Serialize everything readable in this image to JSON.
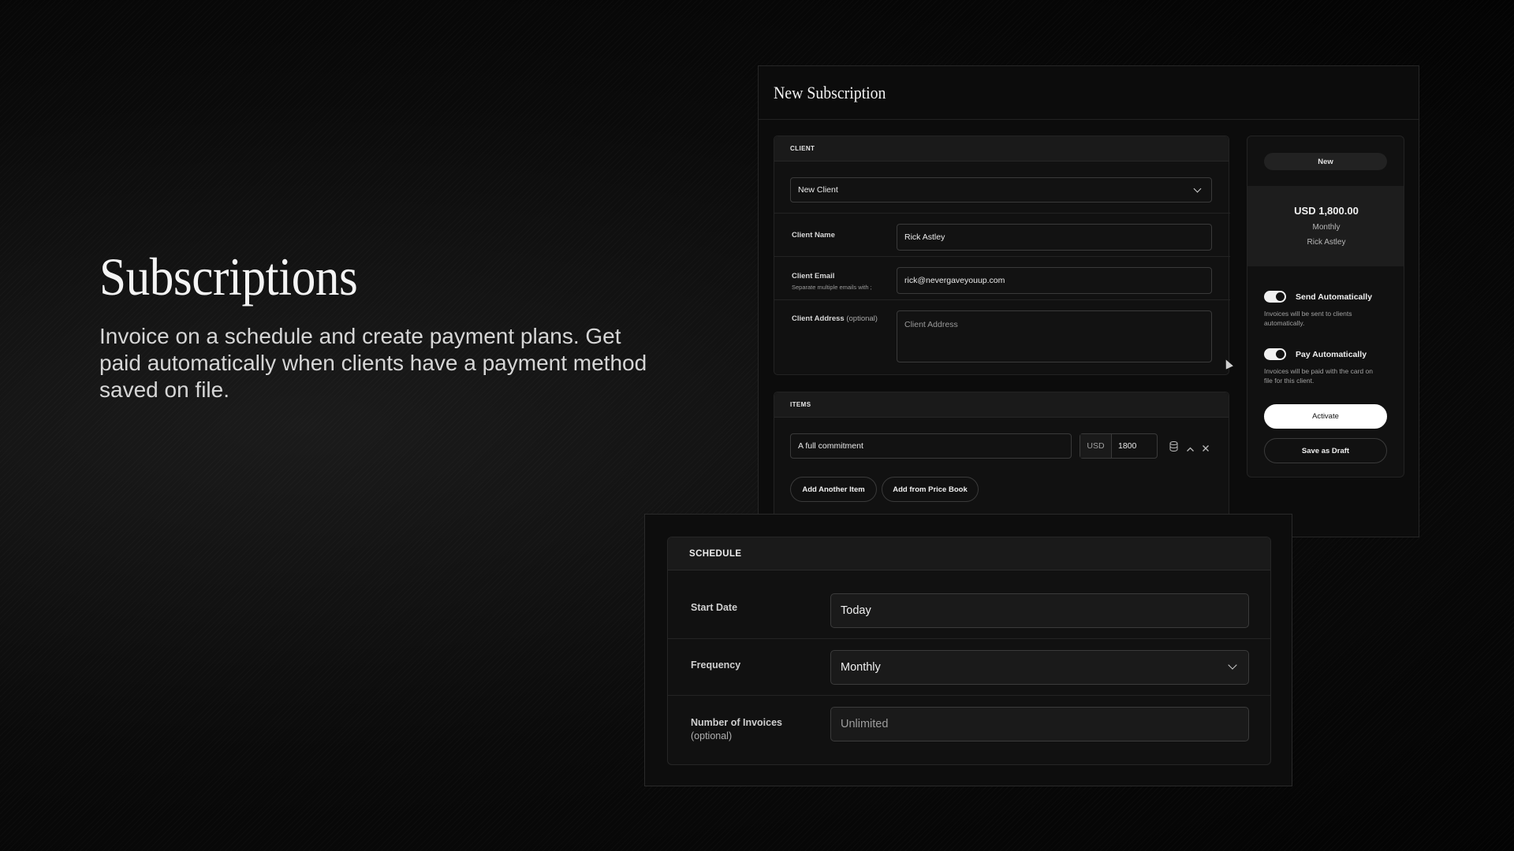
{
  "hero": {
    "title": "Subscriptions",
    "description": "Invoice on a schedule and create payment plans. Get paid automatically when clients have a payment method saved on file."
  },
  "panel": {
    "title": "New Subscription"
  },
  "client": {
    "section_title": "CLIENT",
    "select_value": "New Client",
    "name_label": "Client Name",
    "name_value": "Rick Astley",
    "email_label": "Client Email",
    "email_hint": "Separate multiple emails with ;",
    "email_value": "rick@nevergaveyouup.com",
    "address_label": "Client Address",
    "address_optional": "(optional)",
    "address_placeholder": "Client Address"
  },
  "items": {
    "section_title": "ITEMS",
    "rows": [
      {
        "description": "A full commitment",
        "currency": "USD",
        "amount": "1800"
      }
    ],
    "add_item_label": "Add Another Item",
    "add_price_book_label": "Add from Price Book"
  },
  "sidebar": {
    "status_badge": "New",
    "total": "USD 1,800.00",
    "frequency": "Monthly",
    "client_name": "Rick Astley",
    "send_auto_label": "Send Automatically",
    "send_auto_desc": "Invoices will be sent to clients automatically.",
    "pay_auto_label": "Pay Automatically",
    "pay_auto_desc": "Invoices will be paid with the card on file for this client.",
    "activate_label": "Activate",
    "save_draft_label": "Save as Draft"
  },
  "schedule": {
    "section_title": "SCHEDULE",
    "start_date_label": "Start Date",
    "start_date_value": "Today",
    "frequency_label": "Frequency",
    "frequency_value": "Monthly",
    "invoices_label": "Number of Invoices",
    "invoices_optional": "(optional)",
    "invoices_placeholder": "Unlimited"
  },
  "colors": {
    "background": "#050505",
    "panel": "#0c0c0c",
    "accent_button": "#ffffff"
  }
}
